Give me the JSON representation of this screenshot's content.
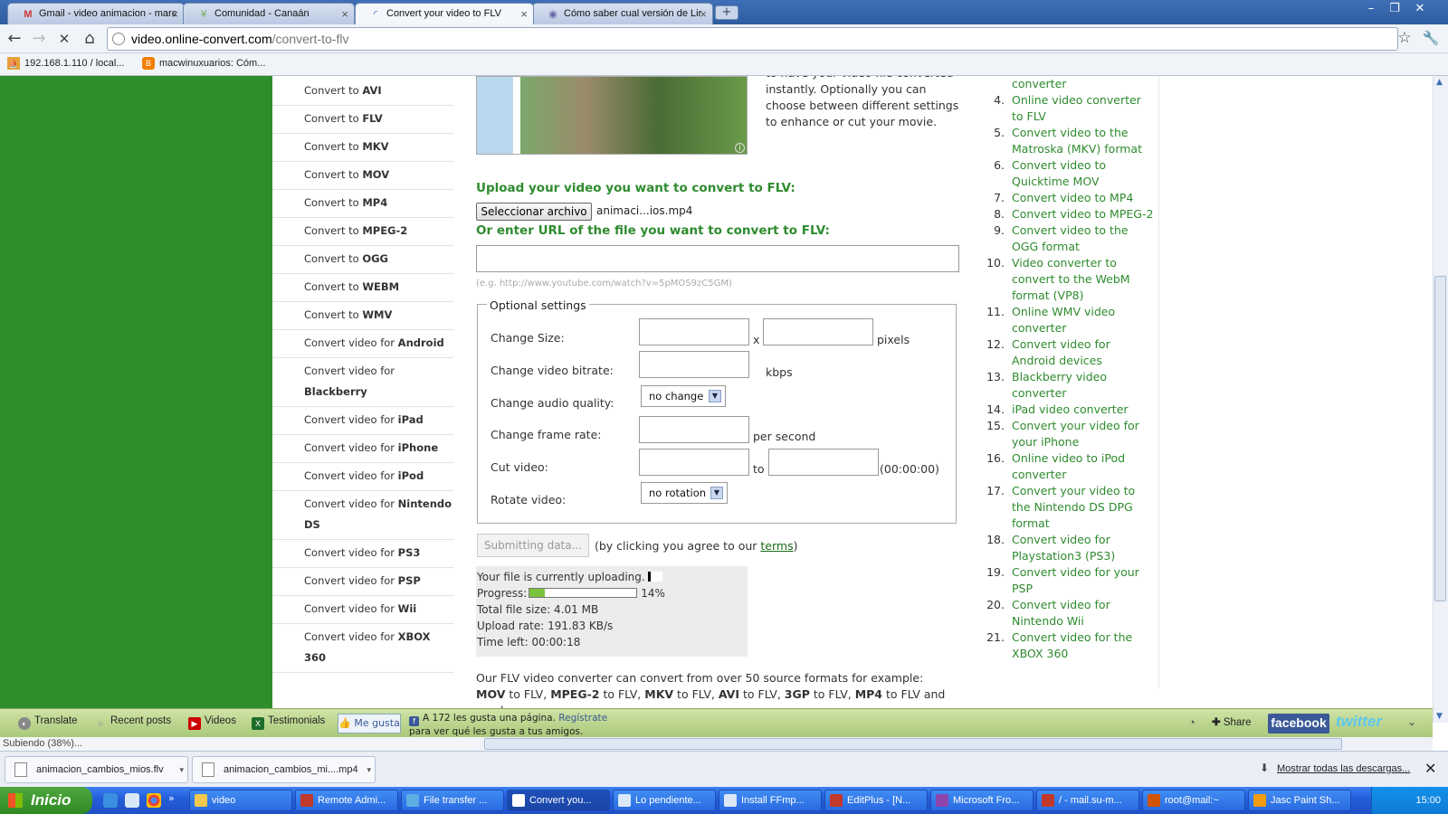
{
  "browser": {
    "tabs": [
      {
        "title": "Gmail - video animacion - marc",
        "icon": "gmail-icon"
      },
      {
        "title": "Comunidad - Canaán",
        "icon": "site-icon"
      },
      {
        "title": "Convert your video to FLV",
        "icon": "loading-icon"
      },
      {
        "title": "Cómo saber cual versión de Lir",
        "icon": "site-icon"
      }
    ],
    "new_tab": "+",
    "url_domain": "video.online-convert.com",
    "url_path": "/convert-to-flv",
    "bookmarks": [
      {
        "label": "192.168.1.110 / local...",
        "icon": "phpmyadmin-icon"
      },
      {
        "label": "macwinuxuarios: Cóm...",
        "icon": "blogger-icon"
      }
    ]
  },
  "left_nav": [
    {
      "prefix": "Convert to ",
      "bold": "AVI"
    },
    {
      "prefix": "Convert to ",
      "bold": "FLV"
    },
    {
      "prefix": "Convert to ",
      "bold": "MKV"
    },
    {
      "prefix": "Convert to ",
      "bold": "MOV"
    },
    {
      "prefix": "Convert to ",
      "bold": "MP4"
    },
    {
      "prefix": "Convert to ",
      "bold": "MPEG-2"
    },
    {
      "prefix": "Convert to ",
      "bold": "OGG"
    },
    {
      "prefix": "Convert to ",
      "bold": "WEBM"
    },
    {
      "prefix": "Convert to ",
      "bold": "WMV"
    },
    {
      "prefix": "Convert video for ",
      "bold": "Android"
    },
    {
      "prefix": "Convert video for ",
      "bold": "Blackberry"
    },
    {
      "prefix": "Convert video for ",
      "bold": "iPad"
    },
    {
      "prefix": "Convert video for ",
      "bold": "iPhone"
    },
    {
      "prefix": "Convert video for ",
      "bold": "iPod"
    },
    {
      "prefix": "Convert video for ",
      "bold": "Nintendo DS"
    },
    {
      "prefix": "Convert video for ",
      "bold": "PS3"
    },
    {
      "prefix": "Convert video for ",
      "bold": "PSP"
    },
    {
      "prefix": "Convert video for ",
      "bold": "Wii"
    },
    {
      "prefix": "Convert video for ",
      "bold": "XBOX 360"
    }
  ],
  "intro_text": "to have your video file converted instantly. Optionally you can choose between different settings to enhance or cut your movie.",
  "upload": {
    "heading": "Upload your video you want to convert to FLV:",
    "file_button": "Seleccionar archivo",
    "file_name": "animaci...ios.mp4",
    "url_heading": "Or enter URL of the file you want to convert to FLV:",
    "url_value": "",
    "url_hint": "(e.g. http://www.youtube.com/watch?v=5pMOS9zC5GM)"
  },
  "optional": {
    "legend": "Optional settings",
    "size_label": "Change Size:",
    "size_x": "x",
    "size_unit": "pixels",
    "bitrate_label": "Change video bitrate:",
    "bitrate_unit": "kbps",
    "audio_label": "Change audio quality:",
    "audio_value": "no change",
    "framerate_label": "Change frame rate:",
    "framerate_unit": "per second",
    "cut_label": "Cut video:",
    "cut_to": "to",
    "cut_format": "(00:00:00)",
    "rotate_label": "Rotate video:",
    "rotate_value": "no rotation"
  },
  "submit": {
    "button": "Submitting data...",
    "agree_prefix": "(by clicking you agree to our ",
    "agree_link": "terms",
    "agree_suffix": ")"
  },
  "upload_status": {
    "uploading_text": "Your file is currently uploading.",
    "progress_label": "Progress:",
    "progress_percent": "14%",
    "progress_value": 14,
    "total_size": "Total file size: 4.01 MB",
    "upload_rate": "Upload rate: 191.83 KB/s",
    "time_left": "Time left: 00:00:18"
  },
  "body_text": {
    "lead": "Our FLV video converter can convert from over 50 source formats for example: ",
    "items": [
      {
        "fmt": "MOV",
        "sep": " to FLV, "
      },
      {
        "fmt": "MPEG-2",
        "sep": " to FLV, "
      },
      {
        "fmt": "MKV",
        "sep": " to FLV, "
      },
      {
        "fmt": "AVI",
        "sep": " to FLV, "
      },
      {
        "fmt": "3GP",
        "sep": " to FLV, "
      },
      {
        "fmt": "MP4",
        "sep": " to FLV and much"
      }
    ]
  },
  "right_list": [
    {
      "num": "",
      "text": "converter"
    },
    {
      "num": "4.",
      "text": "Online video converter to FLV"
    },
    {
      "num": "5.",
      "text": "Convert video to the Matroska (MKV) format"
    },
    {
      "num": "6.",
      "text": "Convert video to Quicktime MOV"
    },
    {
      "num": "7.",
      "text": "Convert video to MP4"
    },
    {
      "num": "8.",
      "text": "Convert video to MPEG-2"
    },
    {
      "num": "9.",
      "text": "Convert video to the OGG format"
    },
    {
      "num": "10.",
      "text": "Video converter to convert to the WebM format (VP8)"
    },
    {
      "num": "11.",
      "text": "Online WMV video converter"
    },
    {
      "num": "12.",
      "text": "Convert video for Android devices"
    },
    {
      "num": "13.",
      "text": "Blackberry video converter"
    },
    {
      "num": "14.",
      "text": "iPad video converter"
    },
    {
      "num": "15.",
      "text": "Convert your video for your iPhone"
    },
    {
      "num": "16.",
      "text": "Online video to iPod converter"
    },
    {
      "num": "17.",
      "text": "Convert your video to the Nintendo DS DPG format"
    },
    {
      "num": "18.",
      "text": "Convert video for Playstation3 (PS3)"
    },
    {
      "num": "19.",
      "text": "Convert video for your PSP"
    },
    {
      "num": "20.",
      "text": "Convert video for Nintendo Wii"
    },
    {
      "num": "21.",
      "text": "Convert video for the XBOX 360"
    }
  ],
  "share_bar": {
    "translate": "Translate",
    "recent": "Recent posts",
    "videos": "Videos",
    "testimonials": "Testimonials",
    "like": "Me gusta",
    "fb_text_a": "A 172 les gusta una página. ",
    "fb_link": "Regístrate",
    "fb_text_b": " para ver qué les gusta a tus amigos.",
    "share": "Share",
    "facebook": "facebook",
    "twitter": "twitter"
  },
  "status_text": "Subiendo (38%)...",
  "downloads": {
    "items": [
      "animacion_cambios_mios.flv",
      "animacion_cambios_mi....mp4"
    ],
    "show_all": "Mostrar todas las descargas..."
  },
  "taskbar": {
    "start": "Inicio",
    "items": [
      "video",
      "Remote Admi...",
      "File transfer ...",
      "Convert you...",
      "Lo pendiente...",
      "Install FFmp...",
      "EditPlus - [N...",
      "Microsoft Fro...",
      "/ - mail.su-m...",
      "root@mail:~",
      "Jasc Paint Sh..."
    ],
    "clock": "15:00"
  },
  "colors": {
    "accent_green": "#2e8b2e",
    "left_band": "#2f8e2c",
    "progress": "#7cc23c"
  }
}
